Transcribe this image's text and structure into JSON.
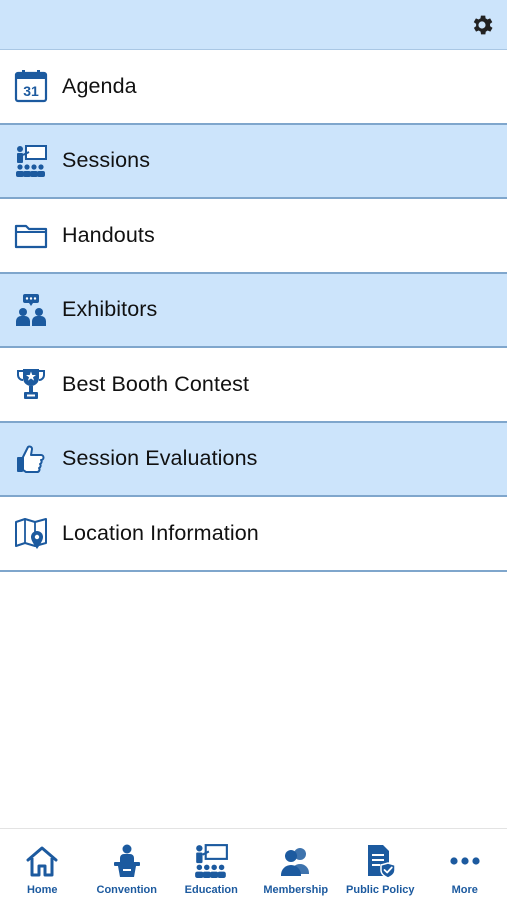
{
  "header": {
    "settings_icon": "gear-icon"
  },
  "menu": {
    "items": [
      {
        "label": "Agenda",
        "icon": "calendar-icon"
      },
      {
        "label": "Sessions",
        "icon": "presentation-icon"
      },
      {
        "label": "Handouts",
        "icon": "folder-icon"
      },
      {
        "label": "Exhibitors",
        "icon": "exhibitors-icon"
      },
      {
        "label": "Best Booth Contest",
        "icon": "trophy-icon"
      },
      {
        "label": "Session Evaluations",
        "icon": "thumbs-up-icon"
      },
      {
        "label": "Location Information",
        "icon": "map-pin-icon"
      }
    ],
    "calendar_day": "31"
  },
  "tabbar": {
    "tabs": [
      {
        "label": "Home",
        "icon": "home-icon"
      },
      {
        "label": "Convention",
        "icon": "podium-icon"
      },
      {
        "label": "Education",
        "icon": "presentation-icon"
      },
      {
        "label": "Membership",
        "icon": "people-icon"
      },
      {
        "label": "Public Policy",
        "icon": "policy-document-icon"
      },
      {
        "label": "More",
        "icon": "more-icon"
      }
    ]
  },
  "colors": {
    "accent": "#1c5a9f",
    "row_alt_bg": "#cce4fb",
    "divider": "#7fa6cc"
  }
}
